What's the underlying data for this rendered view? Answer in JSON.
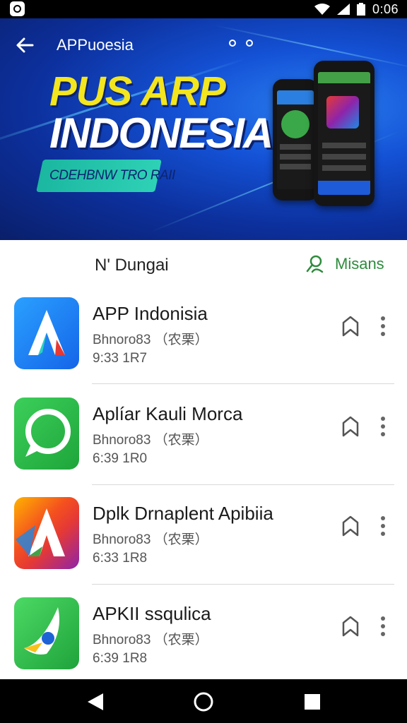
{
  "status_bar": {
    "time": "0:06"
  },
  "banner": {
    "title": "APPuoesia",
    "headline_1": "PUS ARP",
    "headline_2": "INDONESIA",
    "ribbon_text": "CDEHBNW TRO RAII"
  },
  "list_header": {
    "title": "N' Dungai",
    "action_label": "Misans"
  },
  "apps": [
    {
      "name": "APP Indonisia",
      "subtitle": "Bhnoro83 （农栗）",
      "meta": "9:33 1R7"
    },
    {
      "name": "Aplíar Kauli Morca",
      "subtitle": "Bhnoro83 （农栗）",
      "meta": "6:39 1R0"
    },
    {
      "name": "Dplk Drnaplent Apibiia",
      "subtitle": "Bhnoro83 （农栗）",
      "meta": "6:33 1R8"
    },
    {
      "name": "APKII ssqulica",
      "subtitle": "Bhnoro83 （农栗）",
      "meta": "6:39 1R8"
    }
  ],
  "icons": {
    "back": "back-arrow-icon",
    "menu": "menu-dots-icon",
    "search": "person-search-icon",
    "bookmark": "bookmark-icon",
    "more": "more-vertical-icon",
    "nav_back": "nav-back-icon",
    "nav_home": "nav-home-icon",
    "nav_recents": "nav-recents-icon"
  },
  "colors": {
    "banner_primary": "#1452d6",
    "headline_yellow": "#f3e51e",
    "accent_green": "#2e8b3c",
    "ribbon_teal": "#2ed1b6"
  }
}
